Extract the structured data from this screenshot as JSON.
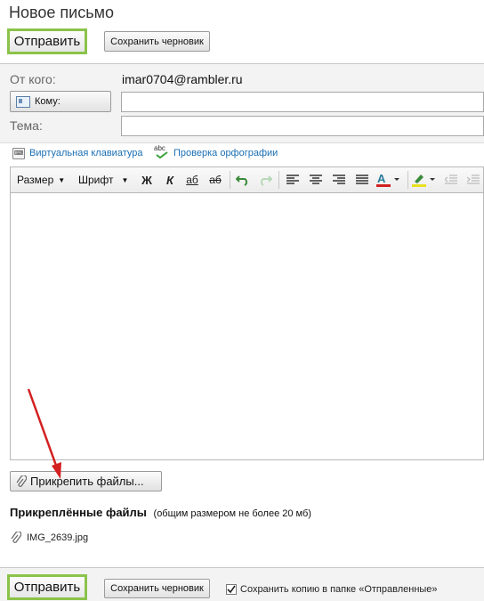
{
  "header": {
    "title": "Новое письмо"
  },
  "top_actions": {
    "send_label": "Отправить",
    "draft_label": "Сохранить черновик"
  },
  "form": {
    "from_label": "От кого:",
    "from_value": "imar0704@rambler.ru",
    "to_button_label": "Кому:",
    "to_value": "",
    "subject_label": "Тема:",
    "subject_value": ""
  },
  "tools": {
    "keyboard_label": "Виртуальная клавиатура",
    "spell_label": "Проверка орфографии",
    "spell_icon_text": "abc"
  },
  "toolbar": {
    "size_label": "Размер",
    "font_label": "Шрифт",
    "bold": "Ж",
    "italic": "К",
    "underline": "аб",
    "strike": "аб"
  },
  "attachments": {
    "attach_button_label": "Прикрепить файлы...",
    "heading": "Прикреплённые файлы",
    "note": "(общим размером не более 20 мб)",
    "files": [
      {
        "name": "IMG_2639.jpg"
      }
    ]
  },
  "bottom_actions": {
    "send_label": "Отправить",
    "draft_label": "Сохранить черновик",
    "save_copy_label": "Сохранить копию в папке «Отправленные»",
    "save_copy_checked": true
  },
  "colors": {
    "accent_green": "#8bc34a",
    "link_blue": "#1a6fb4",
    "arrow_red": "#d32020"
  }
}
